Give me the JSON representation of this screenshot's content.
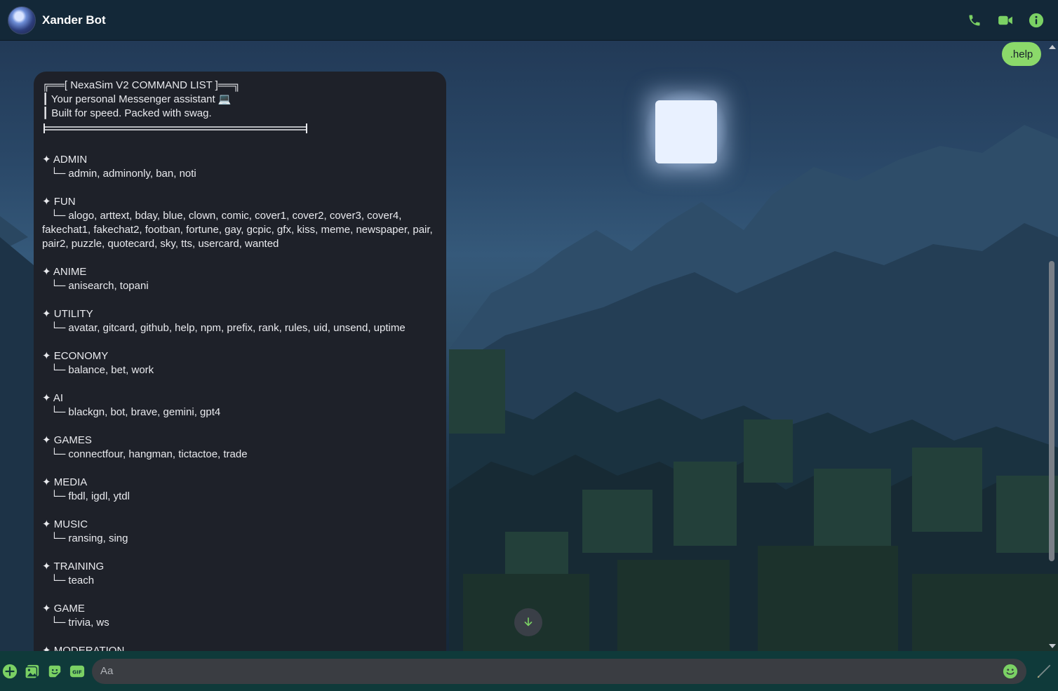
{
  "header": {
    "title": "Xander Bot",
    "accent": "#7bd164"
  },
  "messages": {
    "user": ".help",
    "bot": {
      "banner": [
        "╔══[ NexaSim V2 COMMAND LIST ]══╗",
        "┃ Your personal Messenger assistant 💻",
        "┃ Built for speed. Packed with swag."
      ],
      "categories": [
        {
          "name": "✦ ADMIN",
          "commands": "└─ admin, adminonly, ban, noti"
        },
        {
          "name": "✦ FUN",
          "commands": "└─ alogo, arttext, bday, blue, clown, comic, cover1, cover2, cover3, cover4, fakechat1, fakechat2, footban, fortune, gay, gcpic, gfx, kiss, meme, newspaper, pair, pair2, puzzle, quotecard, sky, tts, usercard, wanted"
        },
        {
          "name": "✦ ANIME",
          "commands": "└─ anisearch, topani"
        },
        {
          "name": "✦ UTILITY",
          "commands": "└─ avatar, gitcard, github, help, npm, prefix, rank, rules, uid, unsend, uptime"
        },
        {
          "name": "✦ ECONOMY",
          "commands": "└─ balance, bet, work"
        },
        {
          "name": "✦ AI",
          "commands": "└─ blackgn, bot, brave, gemini, gpt4"
        },
        {
          "name": "✦ GAMES",
          "commands": "└─ connectfour, hangman, tictactoe, trade"
        },
        {
          "name": "✦ MEDIA",
          "commands": "└─ fbdl, igdl, ytdl"
        },
        {
          "name": "✦ MUSIC",
          "commands": "└─ ransing, sing"
        },
        {
          "name": "✦ TRAINING",
          "commands": "└─ teach"
        },
        {
          "name": "✦ GAME",
          "commands": "└─ trivia, ws"
        },
        {
          "name": "✦ MODERATION",
          "commands": ""
        }
      ]
    }
  },
  "composer": {
    "placeholder": "Aa",
    "gif_label": "GIF"
  }
}
